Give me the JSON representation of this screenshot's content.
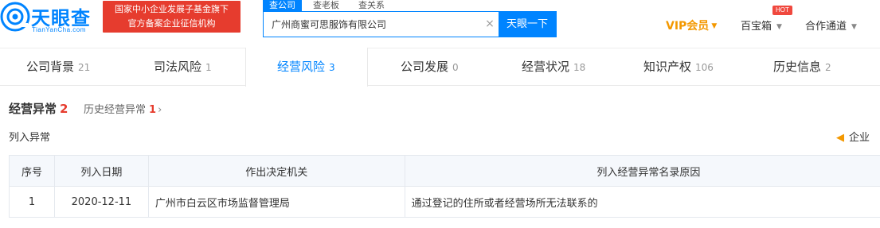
{
  "brand": {
    "name": "天眼查",
    "domain_text": "TianYanCha.com",
    "promo_line1": "国家中小企业发展子基金旗下",
    "promo_line2": "官方备案企业征信机构",
    "accent_color": "#0084ff",
    "promo_color": "#e63c2e"
  },
  "search": {
    "tabs": [
      "查公司",
      "查老板",
      "查关系"
    ],
    "value": "广州商蜜可思服饰有限公司",
    "clear_icon": "close-icon",
    "button_label": "天眼一下"
  },
  "header_nav": {
    "vip_label": "VIP会员",
    "treasure_label": "百宝箱",
    "hot_badge": "HOT",
    "partner_label": "合作通道"
  },
  "tabs": [
    {
      "label": "公司背景",
      "count": "21"
    },
    {
      "label": "司法风险",
      "count": "1"
    },
    {
      "label": "经营风险",
      "count": "3"
    },
    {
      "label": "公司发展",
      "count": "0"
    },
    {
      "label": "经营状况",
      "count": "18"
    },
    {
      "label": "知识产权",
      "count": "106"
    },
    {
      "label": "历史信息",
      "count": "2"
    }
  ],
  "section": {
    "title": "经营异常",
    "count": "2",
    "history_label": "历史经营异常",
    "history_count": "1",
    "subtitle": "列入异常",
    "notice_label": "企业"
  },
  "table": {
    "headers": [
      "序号",
      "列入日期",
      "作出决定机关",
      "列入经营异常名录原因"
    ],
    "rows": [
      [
        "1",
        "2020-12-11",
        "广州市白云区市场监督管理局",
        "通过登记的住所或者经营场所无法联系的"
      ]
    ]
  }
}
